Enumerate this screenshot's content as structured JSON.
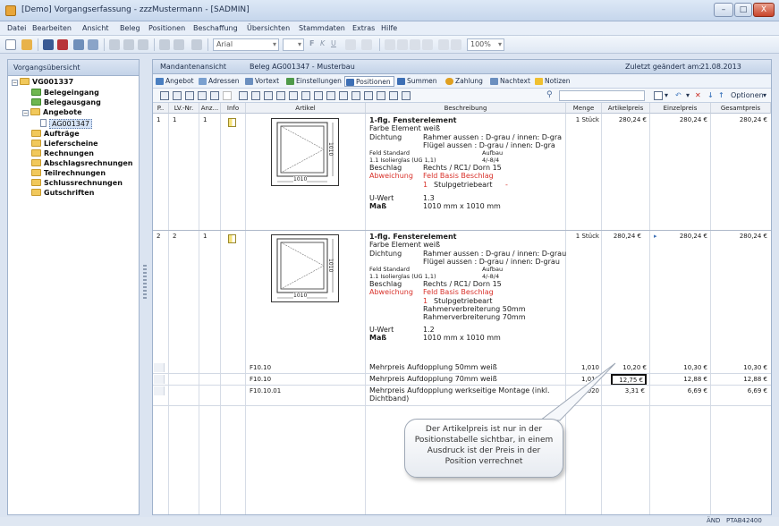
{
  "window": {
    "title": "[Demo] Vorgangserfassung - zzzMustermann - [SADMIN]",
    "buttons": [
      "–",
      "□",
      "X"
    ]
  },
  "menu": [
    "Datei",
    "Bearbeiten",
    "Ansicht",
    "Beleg",
    "Positionen",
    "Beschaffung",
    "Übersichten",
    "Stammdaten",
    "Extras",
    "Hilfe"
  ],
  "toolbar": {
    "font_name": "Arial",
    "zoom": "100%",
    "format_buttons": [
      "F",
      "K",
      "U"
    ]
  },
  "left_panel": {
    "header": "Vorgangsübersicht",
    "tree": [
      {
        "label": "VG001337",
        "expander": "−"
      },
      {
        "label": "Belegeingang"
      },
      {
        "label": "Belegausgang"
      },
      {
        "label": "Angebote",
        "expander": "−"
      },
      {
        "label": "AG001347"
      },
      {
        "label": "Aufträge"
      },
      {
        "label": "Lieferscheine"
      },
      {
        "label": "Rechnungen"
      },
      {
        "label": "Abschlagsrechnungen"
      },
      {
        "label": "Teilrechnungen"
      },
      {
        "label": "Schlussrechnungen"
      },
      {
        "label": "Gutschriften"
      }
    ]
  },
  "right_panel": {
    "view": "Mandantenansicht",
    "beleg": "Beleg AG001347 - Musterbau",
    "changed_label": "Zuletzt geändert am:",
    "changed_date": "21.08.2013",
    "tabs": [
      {
        "label": "Angebot",
        "color": "#4a7fc1"
      },
      {
        "label": "Adressen",
        "color": "#7aa0cf"
      },
      {
        "label": "Vortext",
        "color": "#6b8fbf"
      },
      {
        "label": "Einstellungen",
        "color": "#4f9a4a"
      },
      {
        "label": "Positionen",
        "color": "#3d6fb5"
      },
      {
        "label": "Summen",
        "color": "#3d6fb5"
      },
      {
        "label": "Zahlung",
        "color": "#e0a020"
      },
      {
        "label": "Nachtext",
        "color": "#6b8fbf"
      },
      {
        "label": "Notizen",
        "color": "#f0c030"
      }
    ],
    "options_label": "Optionen",
    "columns": [
      "P..",
      "LV.-Nr.",
      "Anz...",
      "Info",
      "Artikel",
      "Beschreibung",
      "Menge",
      "Artikelpreis",
      "Einzelpreis",
      "Gesamtpreis"
    ]
  },
  "positions": [
    {
      "p": "1",
      "lv": "1",
      "anz": "1",
      "menge": "1 Stück",
      "artikelpreis": "280,24 €",
      "einzelpreis": "280,24 €",
      "gesamtpreis": "280,24 €",
      "dim_w": "1010",
      "dim_h": "1010",
      "lines": {
        "title": "1-flg. Fensterelement",
        "farbe": "Farbe Element  weiß",
        "dichtung_l": "Dichtung",
        "dichtung_v1": "Rahmer aussen : D-grau / innen: D-gra",
        "dichtung_v2": "Flügel aussen : D-grau / innen: D-gra",
        "feld": "Feld  Standard",
        "aufbau": "Aufbau",
        "glas": "1.1  Isolierglas (UG 1,1)",
        "glas_v": "4/-8/4",
        "beschlag_l": "Beschlag",
        "beschlag_v": "Rechts / RC1/ Dorn 15",
        "abw_l": "Abweichung",
        "abw_v": "Feld   Basis Beschlag",
        "abw_n": "1",
        "abw_n_v": "Stulpgetriebeart",
        "abw_dash": "-",
        "uwert_l": "U-Wert",
        "uwert_v": "1.3",
        "mass_l": "Maß",
        "mass_v": "1010 mm x  1010 mm"
      }
    },
    {
      "p": "2",
      "lv": "2",
      "anz": "1",
      "menge": "1 Stück",
      "artikelpreis": "280,24 €",
      "einzelpreis": "280,24 €",
      "gesamtpreis": "280,24 €",
      "dim_w": "1010",
      "dim_h": "1010",
      "lines": {
        "title": "1-flg. Fensterelement",
        "farbe": "Farbe Element  weiß",
        "dichtung_l": "Dichtung",
        "dichtung_v1": "Rahmer aussen : D-grau / innen: D-grau",
        "dichtung_v2": "Flügel aussen : D-grau / innen: D-grau",
        "feld": "Feld  Standard",
        "aufbau": "Aufbau",
        "glas": "1.1  Isolierglas (UG 1,1)",
        "glas_v": "4/-8/4",
        "beschlag_l": "Beschlag",
        "beschlag_v": "Rechts / RC1/ Dorn 15",
        "abw_l": "Abweichung",
        "abw_v": "Feld   Basis Beschlag",
        "abw_n": "1",
        "abw_n_v": "Stulpgetriebeart",
        "extra1": "Rahmerverbreiterung 50mm",
        "extra2": "Rahmerverbreiterung 70mm",
        "uwert_l": "U-Wert",
        "uwert_v": "1.2",
        "mass_l": "Maß",
        "mass_v": "1010 mm x  1010 mm"
      }
    }
  ],
  "sub_rows": [
    {
      "artikel": "F10.10",
      "desc": "Mehrpreis Aufdopplung 50mm weiß",
      "menge": "1,010",
      "artikelpreis": "10,20 €",
      "einzelpreis": "10,30 €",
      "gesamtpreis": "10,30 €"
    },
    {
      "artikel": "F10.10",
      "desc": "Mehrpreis Aufdopplung 70mm weiß",
      "menge": "1,010",
      "artikelpreis": "12,75 €",
      "einzelpreis": "12,88 €",
      "gesamtpreis": "12,88 €"
    },
    {
      "artikel": "F10.10.01",
      "desc": "Mehrpreis Aufdopplung werkseitige Montage (inkl.",
      "desc2": "Dichtband)",
      "menge": "2,020",
      "artikelpreis": "3,31 €",
      "einzelpreis": "6,69 €",
      "gesamtpreis": "6,69 €"
    }
  ],
  "callout": "Der Artikelpreis ist nur in der Positionstabelle sichtbar, in einem Ausdruck ist der Preis in der Position verrechnet",
  "status": {
    "mode": "ÄND",
    "code": "PTAB42400"
  }
}
